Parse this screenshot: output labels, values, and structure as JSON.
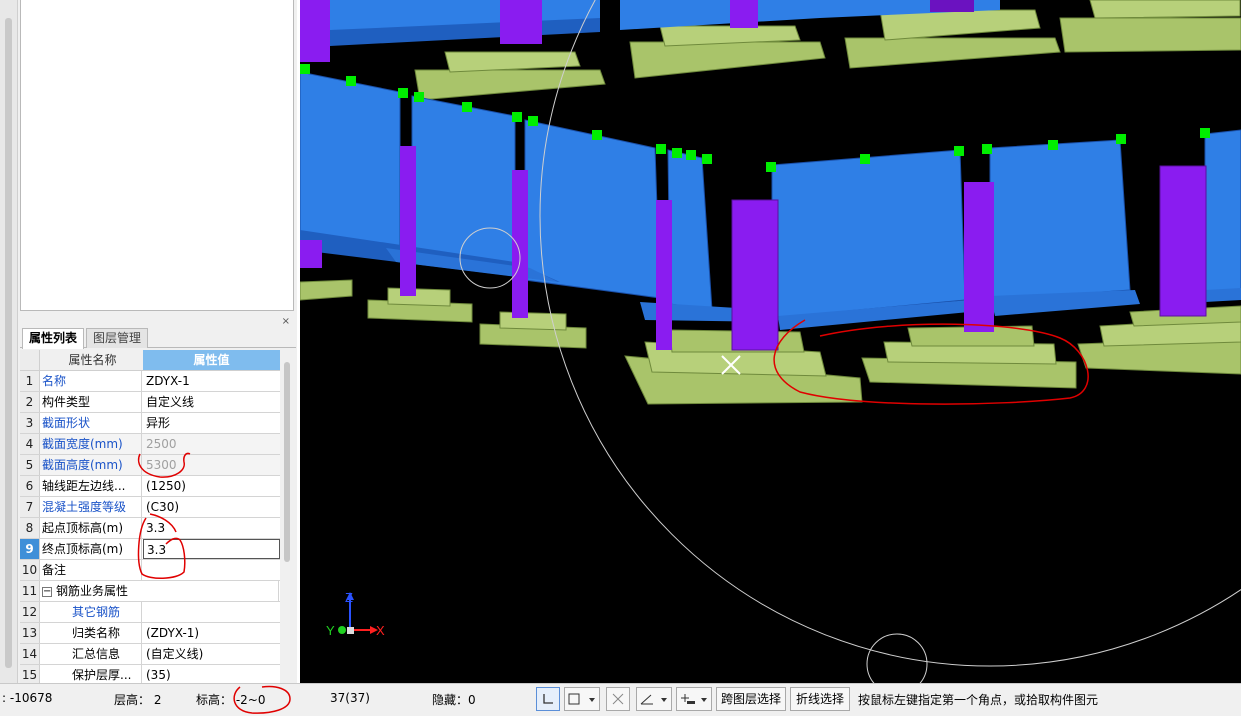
{
  "prop_panel": {
    "close": "×",
    "tabs": [
      "属性列表",
      "图层管理"
    ],
    "header": {
      "name": "属性名称",
      "value": "属性值"
    },
    "rows": [
      {
        "num": "1",
        "name": "名称",
        "value": "ZDYX-1"
      },
      {
        "num": "2",
        "name": "构件类型",
        "value": "自定义线"
      },
      {
        "num": "3",
        "name": "截面形状",
        "value": "异形"
      },
      {
        "num": "4",
        "name": "截面宽度(mm)",
        "value": "2500"
      },
      {
        "num": "5",
        "name": "截面高度(mm)",
        "value": "5300"
      },
      {
        "num": "6",
        "name": "轴线距左边线...",
        "value": "(1250)"
      },
      {
        "num": "7",
        "name": "混凝土强度等级",
        "value": "(C30)"
      },
      {
        "num": "8",
        "name": "起点顶标高(m)",
        "value": "3.3"
      },
      {
        "num": "9",
        "name": "终点顶标高(m)",
        "value": "3.3"
      },
      {
        "num": "10",
        "name": "备注",
        "value": ""
      },
      {
        "num": "11",
        "name": "钢筋业务属性",
        "value": "",
        "expander": "−"
      },
      {
        "num": "12",
        "name": "其它钢筋",
        "value": ""
      },
      {
        "num": "13",
        "name": "归类名称",
        "value": "(ZDYX-1)"
      },
      {
        "num": "14",
        "name": "汇总信息",
        "value": "(自定义线)"
      },
      {
        "num": "15",
        "name": "保护层厚...",
        "value": "(35)"
      }
    ]
  },
  "axes": {
    "z": "Z",
    "y": "Y",
    "x": "X"
  },
  "status": {
    "coord": "-10678",
    "floor_height": "层高：  2",
    "elevation": "标高：  -2~0",
    "count": "37(37)",
    "hidden": "隐藏：0",
    "cross_layer": "跨图层选择",
    "polyline": "折线选择",
    "hint": "按鼠标左键指定第一个角点，或拾取构件图元"
  },
  "colors": {
    "wall": "#2f7fe6",
    "wall_dark": "#1f5fc0",
    "column": "#8a1cf0",
    "footing": "#a9c46a",
    "handle": "#00ee00",
    "annotation": "#e00000",
    "selection": "#3f8fd8"
  }
}
